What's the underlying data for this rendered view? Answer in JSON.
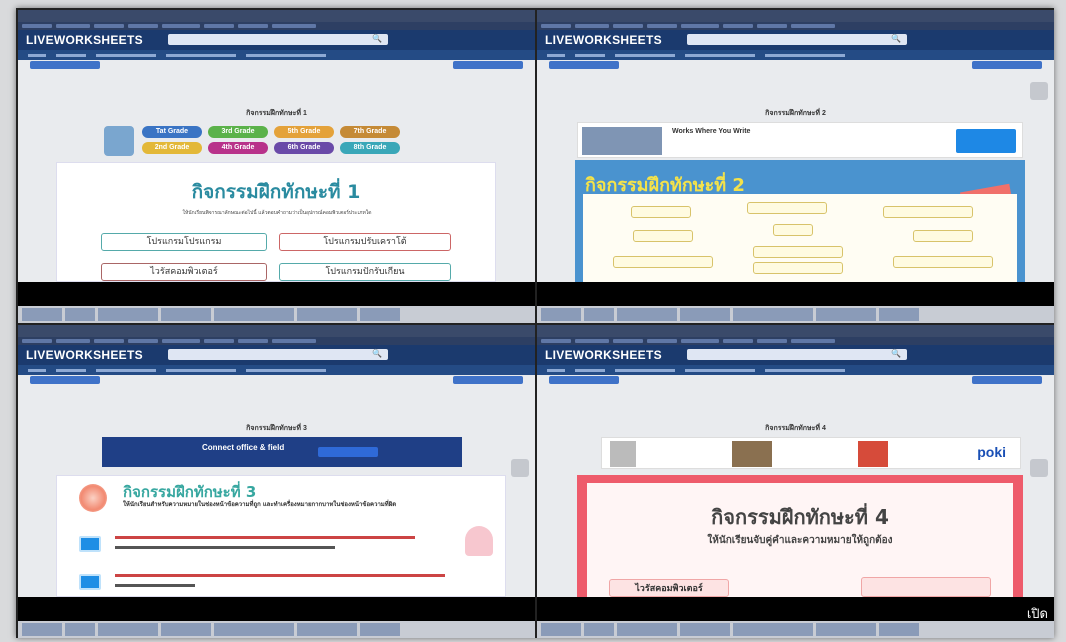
{
  "brand": "LIVEWORKSHEETS",
  "panes": [
    {
      "title": "กิจกรรมฝึกทักษะที่ 1",
      "grades": [
        "Tat Grade",
        "3rd Grade",
        "5th Grade",
        "7th Grade",
        "2nd Grade",
        "4th Grade",
        "6th Grade",
        "8th Grade"
      ],
      "heading": "กิจกรรมฝึกทักษะที่ 1",
      "subtext": "ให้นักเรียนพิจารณาลักษณะต่อไปนี้ แล้วตอบคำถามว่าเป็นอุปกรณ์คอมพิวเตอร์ประเภทใด",
      "boxes": [
        "โปรแกรมโปรแกรม",
        "โปรแกรมปรับเคราโต้",
        "ไวรัสคอมพิวเตอร์",
        "โปรแกรมปักรับเกียน"
      ]
    },
    {
      "title": "กิจกรรมฝึกทักษะที่ 2",
      "ad_title": "Works Where You Write",
      "heading": "กิจกรรมฝึกทักษะที่ 2"
    },
    {
      "title": "กิจกรรมฝึกทักษะที่ 3",
      "ad_title": "Connect office & field",
      "heading": "กิจกรรมฝึกทักษะที่ 3",
      "subtext": "ให้นักเรียนสำหรับความหมายในช่องหน้าข้อความที่ถูก และทำเครื่องหมายกากบาทในช่องหน้าข้อความที่ผิด"
    },
    {
      "title": "กิจกรรมฝึกทักษะที่ 4",
      "ad_brand": "poki",
      "heading": "กิจกรรมฝึกทักษะที่ 4",
      "subtext": "ให้นักเรียนจับคู่คำและความหมายให้ถูกต้อง",
      "term": "ไวรัสคอมพิวเตอร์"
    }
  ],
  "watermark": "เปิด"
}
